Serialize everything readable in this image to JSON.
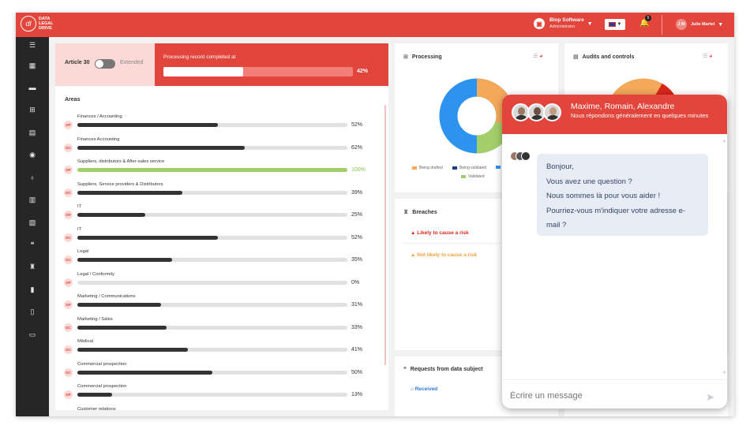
{
  "brand": {
    "logo_text": "DATA\nLEGAL\nDRIVE"
  },
  "topbar": {
    "company_name": "Blop Software",
    "company_role": "Administrator",
    "notifications": "5",
    "user_initials": "J M",
    "user_name": "Julie Martel"
  },
  "article": {
    "label": "Article 30",
    "toggle_label": "Extended"
  },
  "processing_record": {
    "label": "Processing record completed at",
    "percent": "42%",
    "value": 0.42
  },
  "areas": {
    "title": "Areas",
    "items": [
      {
        "badge": "DP",
        "name": "Finances / Accounting",
        "percent": "52%",
        "value": 0.52
      },
      {
        "badge": "DC",
        "name": "Finances Accounting",
        "percent": "62%",
        "value": 0.62
      },
      {
        "badge": "DP",
        "name": "Suppliers, distributors & After-sales service",
        "percent": "100%",
        "value": 1.0
      },
      {
        "badge": "DC",
        "name": "Suppliers, Service providers & Distributors",
        "percent": "39%",
        "value": 0.39
      },
      {
        "badge": "DP",
        "name": "IT",
        "percent": "25%",
        "value": 0.25
      },
      {
        "badge": "DC",
        "name": "IT",
        "percent": "52%",
        "value": 0.52
      },
      {
        "badge": "DC",
        "name": "Legal",
        "percent": "35%",
        "value": 0.35
      },
      {
        "badge": "DP",
        "name": "Legal / Conformity",
        "percent": "0%",
        "value": 0.0
      },
      {
        "badge": "DP",
        "name": "Marketing / Communications",
        "percent": "31%",
        "value": 0.31
      },
      {
        "badge": "DC",
        "name": "Marketing / Sales",
        "percent": "33%",
        "value": 0.33
      },
      {
        "badge": "DC",
        "name": "Médical",
        "percent": "41%",
        "value": 0.41
      },
      {
        "badge": "DC",
        "name": "Commercial prospection",
        "percent": "50%",
        "value": 0.5
      },
      {
        "badge": "DP",
        "name": "Commercial prospection",
        "percent": "13%",
        "value": 0.13
      },
      {
        "badge": "DC",
        "name": "Customer relations",
        "percent": "",
        "value": 0.0
      }
    ]
  },
  "processing": {
    "title": "Processing",
    "legend": [
      "Being drafted",
      "Being validated",
      "Validated"
    ],
    "colors": {
      "drafted": "#f4a95a",
      "being_validated": "#1f3f7a",
      "to_validate": "#2d93ee",
      "validated": "#a3cf6a"
    }
  },
  "audits": {
    "title": "Audits and controls"
  },
  "breaches": {
    "title": "Breaches",
    "likely": "Likely to cause a risk",
    "not_likely": "Not likely to cause a risk"
  },
  "requests": {
    "title": "Requests from data subject",
    "received": "Received"
  },
  "chat": {
    "names": "Maxime, Romain, Alexandre",
    "subtitle": "Nous répondons généralement en quelques minutes",
    "message_lines": [
      "Bonjour,",
      "Vous avez une question ?",
      "Nous sommes là pour vous aider !",
      "Pourriez-vous m'indiquer votre adresse e-mail ?"
    ],
    "input_placeholder": "Écrire un message"
  },
  "icons": [
    "menu-icon",
    "building-icon",
    "briefcase-icon",
    "table-icon",
    "document-icon",
    "target-icon",
    "stethoscope-icon",
    "file-icon",
    "file-alt-icon",
    "quote-icon",
    "org-icon",
    "book-icon",
    "clipboard-icon",
    "card-icon"
  ]
}
